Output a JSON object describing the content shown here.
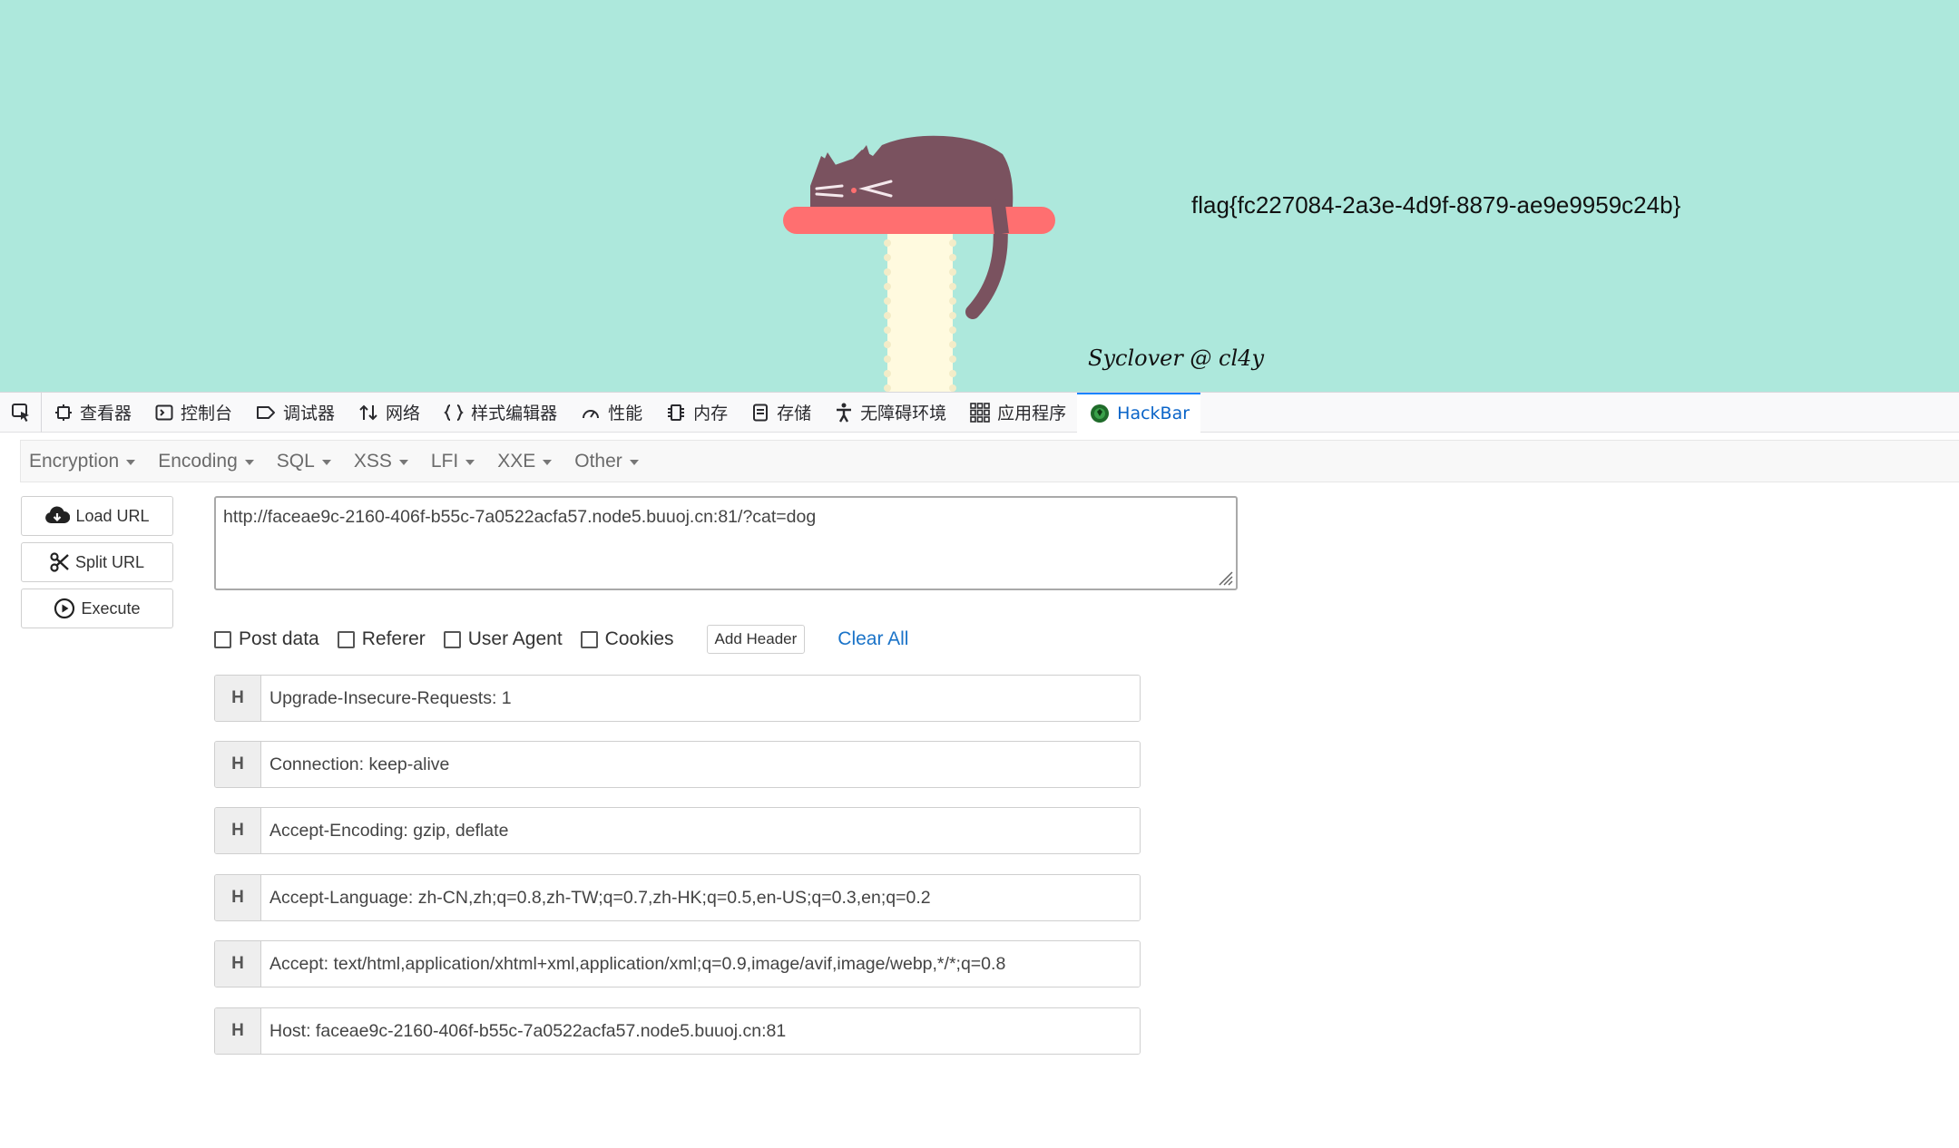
{
  "page": {
    "flag": "flag{fc227084-2a3e-4d9f-8879-ae9e9959c24b}",
    "signature": "Syclover @ cl4y",
    "colors": {
      "background": "#ade8dc",
      "cat": "#7a525f",
      "shelf": "#ff6f70",
      "post": "#fffadf"
    }
  },
  "devtools": {
    "picker_icon": "element-picker-icon",
    "tabs": [
      {
        "label": "查看器",
        "icon": "inspector-icon"
      },
      {
        "label": "控制台",
        "icon": "console-icon"
      },
      {
        "label": "调试器",
        "icon": "debugger-icon"
      },
      {
        "label": "网络",
        "icon": "network-icon"
      },
      {
        "label": "样式编辑器",
        "icon": "style-editor-icon"
      },
      {
        "label": "性能",
        "icon": "performance-icon"
      },
      {
        "label": "内存",
        "icon": "memory-icon"
      },
      {
        "label": "存储",
        "icon": "storage-icon"
      },
      {
        "label": "无障碍环境",
        "icon": "accessibility-icon"
      },
      {
        "label": "应用程序",
        "icon": "application-icon"
      },
      {
        "label": "HackBar",
        "icon": "hackbar-icon",
        "active": true
      }
    ]
  },
  "hackbar": {
    "menu": [
      "Encryption",
      "Encoding",
      "SQL",
      "XSS",
      "LFI",
      "XXE",
      "Other"
    ],
    "buttons": {
      "load_url": "Load URL",
      "split_url": "Split URL",
      "execute": "Execute"
    },
    "url": "http://faceae9c-2160-406f-b55c-7a0522acfa57.node5.buuoj.cn:81/?cat=dog",
    "options": {
      "post_data": "Post data",
      "referer": "Referer",
      "user_agent": "User Agent",
      "cookies": "Cookies",
      "add_header": "Add Header",
      "clear_all": "Clear All"
    },
    "header_prefix": "H",
    "headers": [
      "Upgrade-Insecure-Requests: 1",
      "Connection: keep-alive",
      "Accept-Encoding: gzip, deflate",
      "Accept-Language: zh-CN,zh;q=0.8,zh-TW;q=0.7,zh-HK;q=0.5,en-US;q=0.3,en;q=0.2",
      "Accept: text/html,application/xhtml+xml,application/xml;q=0.9,image/avif,image/webp,*/*;q=0.8",
      "Host: faceae9c-2160-406f-b55c-7a0522acfa57.node5.buuoj.cn:81"
    ]
  }
}
